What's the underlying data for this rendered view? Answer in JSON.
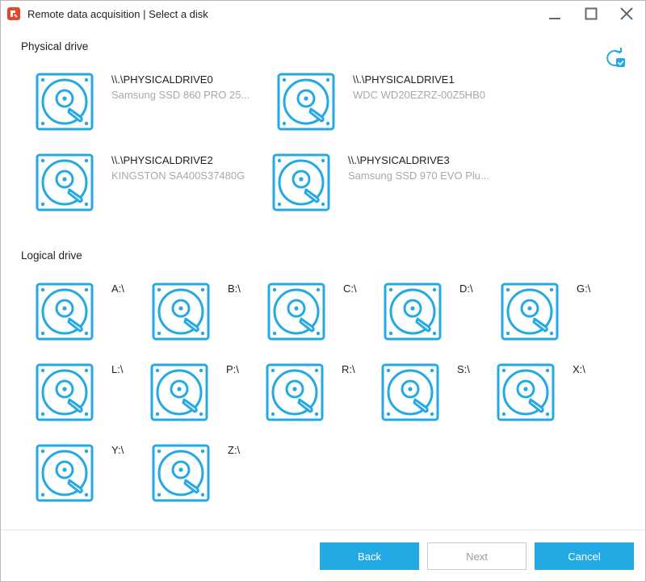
{
  "window": {
    "title": "Remote data acquisition | Select a disk"
  },
  "physical": {
    "title": "Physical drive",
    "drives": [
      {
        "name": "\\\\.\\PHYSICALDRIVE0",
        "model": "Samsung SSD 860 PRO 25..."
      },
      {
        "name": "\\\\.\\PHYSICALDRIVE1",
        "model": "WDC WD20EZRZ-00Z5HB0"
      },
      {
        "name": "\\\\.\\PHYSICALDRIVE2",
        "model": "KINGSTON SA400S37480G"
      },
      {
        "name": "\\\\.\\PHYSICALDRIVE3",
        "model": "Samsung SSD 970 EVO Plu..."
      }
    ]
  },
  "logical": {
    "title": "Logical drive",
    "drives": [
      {
        "name": "A:\\"
      },
      {
        "name": "B:\\"
      },
      {
        "name": "C:\\"
      },
      {
        "name": "D:\\"
      },
      {
        "name": "G:\\"
      },
      {
        "name": "L:\\"
      },
      {
        "name": "P:\\"
      },
      {
        "name": "R:\\"
      },
      {
        "name": "S:\\"
      },
      {
        "name": "X:\\"
      },
      {
        "name": "Y:\\"
      },
      {
        "name": "Z:\\"
      }
    ]
  },
  "footer": {
    "back_label": "Back",
    "next_label": "Next",
    "cancel_label": "Cancel"
  },
  "colors": {
    "accent": "#23a9e3",
    "brand": "#e8452c",
    "disabled_text": "#9c9c9c"
  },
  "icons": {
    "app": "app-logo-icon",
    "refresh": "refresh-icon",
    "disk": "hard-disk-icon"
  }
}
